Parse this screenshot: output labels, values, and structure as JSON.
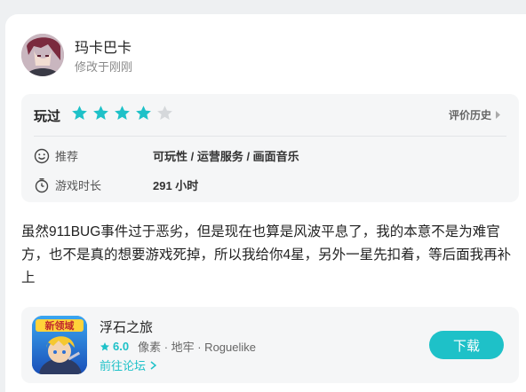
{
  "author": {
    "name": "玛卡巴卡",
    "time": "修改于刚刚"
  },
  "rating": {
    "label": "玩过",
    "stars": 4,
    "max": 5,
    "history_label": "评价历史"
  },
  "details": {
    "recommend_label": "推荐",
    "recommend_value": "可玩性 / 运营服务 / 画面音乐",
    "playtime_label": "游戏时长",
    "playtime_value": "291 小时"
  },
  "review": {
    "text": "虽然911BUG事件过于恶劣，但是现在也算是风波平息了，我的本意不是为难官方，也不是真的想要游戏死掉，所以我给你4星，另外一星先扣着，等后面我再补上"
  },
  "game": {
    "title": "浮石之旅",
    "score": "6.0",
    "tags": "像素 · 地牢 · Roguelike",
    "forum_link": "前往论坛",
    "download_label": "下载",
    "icon_badge": "新领域"
  },
  "colors": {
    "accent": "#1ec1c8",
    "star_empty": "#d5d8db",
    "background": "#eef0f2"
  }
}
